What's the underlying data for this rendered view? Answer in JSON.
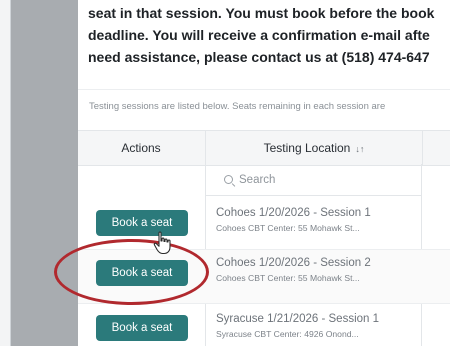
{
  "intro_lines": [
    "seat in that session. You must book before the book",
    "deadline. You will receive a confirmation e-mail afte",
    "need assistance, please contact us at (518) 474-647"
  ],
  "hint": "Testing sessions are listed below. Seats remaining in each session are",
  "table": {
    "col_actions": "Actions",
    "col_location": "Testing Location",
    "search_placeholder": "Search",
    "rows": [
      {
        "button": "Book a seat",
        "name": "Cohoes 1/20/2026 - Session 1",
        "address": "Cohoes CBT Center: 55 Mohawk St..."
      },
      {
        "button": "Book a seat",
        "name": "Cohoes 1/20/2026 - Session 2",
        "address": "Cohoes CBT Center: 55 Mohawk St..."
      },
      {
        "button": "Book a seat",
        "name": "Syracuse 1/21/2026 - Session 1",
        "address": "Syracuse CBT Center: 4926 Onond..."
      }
    ]
  },
  "colors": {
    "button": "#2b7a7b",
    "annotation": "#b1292e"
  },
  "icons": {
    "sort": "sort-arrows-icon",
    "search": "search-icon",
    "cursor": "hand-pointer-cursor-icon"
  }
}
